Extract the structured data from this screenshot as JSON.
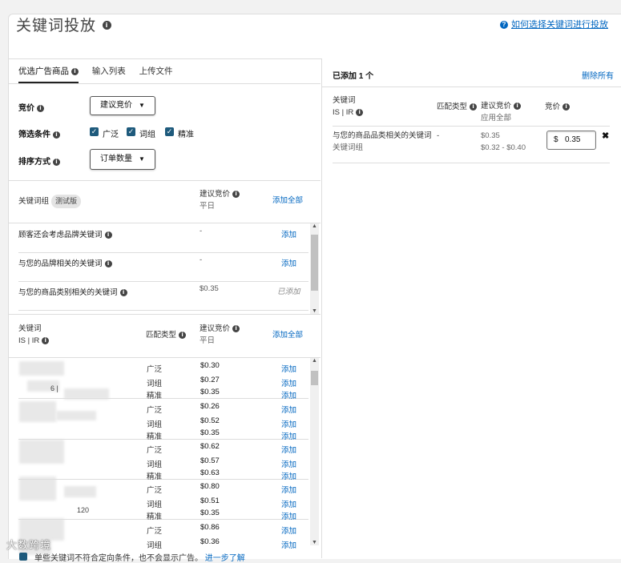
{
  "header": {
    "title": "关键词投放",
    "help_link": "如何选择关键词进行投放"
  },
  "tabs": [
    "优选广告商品",
    "输入列表",
    "上传文件"
  ],
  "filters": {
    "bid_label": "竞价",
    "bid_value": "建议竞价",
    "filter_label": "筛选条件",
    "match_options": [
      "广泛",
      "词组",
      "精准"
    ],
    "sort_label": "排序方式",
    "sort_value": "订单数量"
  },
  "groups_table": {
    "col1": "关键词组",
    "beta": "测试版",
    "col2": "建议竞价",
    "col2_sub": "平日",
    "add_all": "添加全部",
    "rows": [
      {
        "name": "顾客还会考虑品牌关键词",
        "bid": "-",
        "action": "添加"
      },
      {
        "name": "与您的品牌相关的关键词",
        "bid": "-",
        "action": "添加"
      },
      {
        "name": "与您的商品类别相关的关键词",
        "bid": "$0.35",
        "action": "已添加"
      }
    ]
  },
  "keywords_table": {
    "col1": "关键词",
    "col1_sub": "IS | IR",
    "col2": "匹配类型",
    "col3": "建议竞价",
    "col3_sub": "平日",
    "add_all": "添加全部",
    "add": "添加",
    "visible_fragments": [
      "6 |",
      "120"
    ],
    "blocks": [
      {
        "rows": [
          {
            "match": "广泛",
            "bid": "$0.30"
          },
          {
            "match": "词组",
            "bid": "$0.27"
          },
          {
            "match": "精准",
            "bid": "$0.35"
          }
        ]
      },
      {
        "rows": [
          {
            "match": "广泛",
            "bid": "$0.26"
          },
          {
            "match": "词组",
            "bid": "$0.52"
          },
          {
            "match": "精准",
            "bid": "$0.35"
          }
        ]
      },
      {
        "rows": [
          {
            "match": "广泛",
            "bid": "$0.62"
          },
          {
            "match": "词组",
            "bid": "$0.57"
          },
          {
            "match": "精准",
            "bid": "$0.63"
          }
        ]
      },
      {
        "rows": [
          {
            "match": "广泛",
            "bid": "$0.80"
          },
          {
            "match": "词组",
            "bid": "$0.51"
          },
          {
            "match": "精准",
            "bid": "$0.35"
          }
        ]
      },
      {
        "rows": [
          {
            "match": "广泛",
            "bid": "$0.86"
          },
          {
            "match": "词组",
            "bid": "$0.36"
          }
        ]
      }
    ]
  },
  "added_panel": {
    "count_label": "已添加 1 个",
    "remove_all": "删除所有",
    "col1": "关键词",
    "col1_sub": "IS | IR",
    "col2": "匹配类型",
    "col3": "建议竞价",
    "col3_sub": "应用全部",
    "col4": "竞价",
    "row": {
      "name": "与您的商品品类相关的关键词",
      "sub": "关键词组",
      "match": "-",
      "bid": "$0.35",
      "range": "$0.32 - $0.40",
      "currency": "$",
      "value": "0.35",
      "remove": "✖"
    }
  },
  "footer": {
    "note": "单些关键词不符合定向条件，也不会显示广告。",
    "link": "进一步了解"
  },
  "watermark": "大数跨境",
  "colors": {
    "link": "#0066c0",
    "checkbox": "#1e5a7c"
  }
}
